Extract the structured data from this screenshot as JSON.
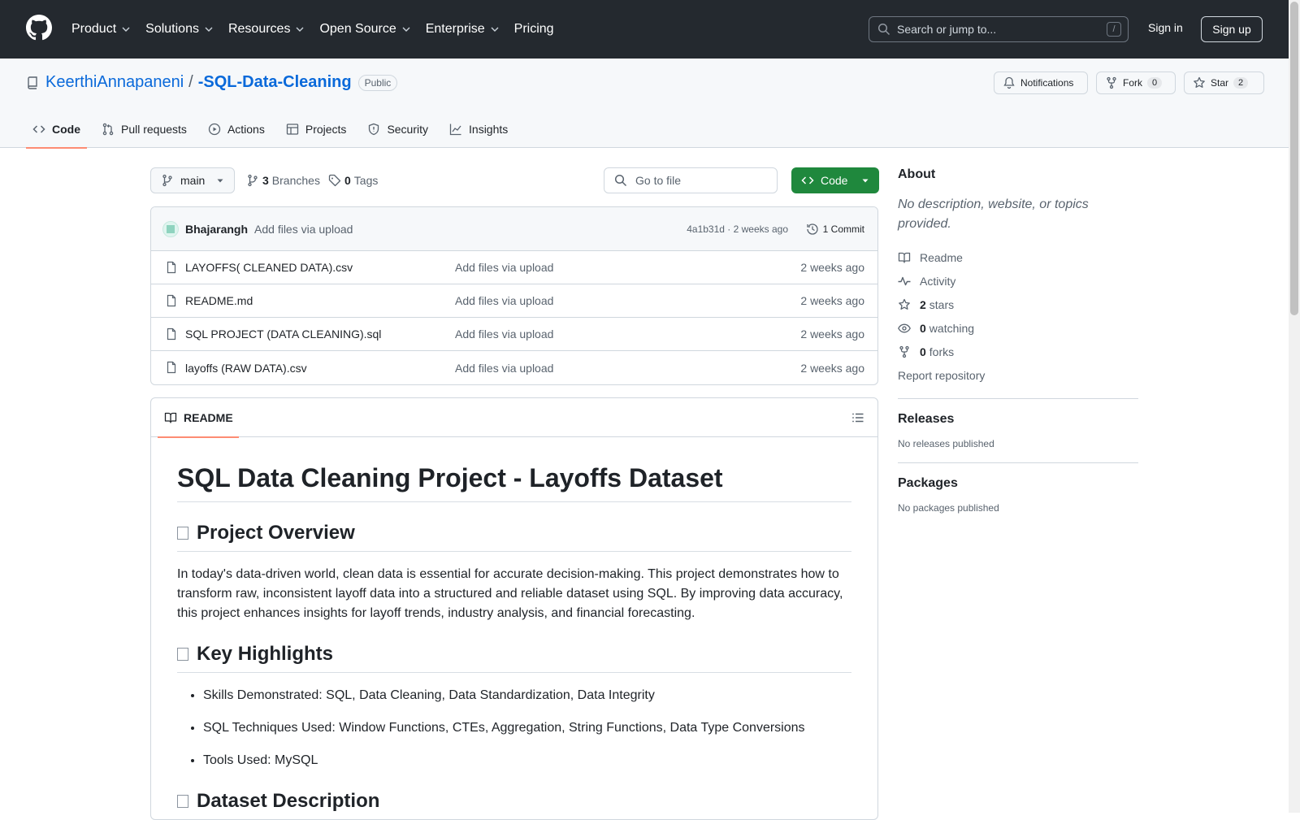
{
  "header": {
    "nav": [
      "Product",
      "Solutions",
      "Resources",
      "Open Source",
      "Enterprise",
      "Pricing"
    ],
    "search_placeholder": "Search or jump to...",
    "search_kbd": "/",
    "sign_in": "Sign in",
    "sign_up": "Sign up"
  },
  "repo": {
    "owner": "KeerthiAnnapaneni",
    "separator": "/",
    "name": "-SQL-Data-Cleaning",
    "visibility": "Public",
    "notifications_label": "Notifications",
    "fork_label": "Fork",
    "fork_count": "0",
    "star_label": "Star",
    "star_count": "2"
  },
  "tabs": [
    {
      "label": "Code",
      "icon": "code-icon",
      "active": true
    },
    {
      "label": "Pull requests",
      "icon": "pull-request-icon"
    },
    {
      "label": "Actions",
      "icon": "play-icon"
    },
    {
      "label": "Projects",
      "icon": "table-icon"
    },
    {
      "label": "Security",
      "icon": "shield-icon"
    },
    {
      "label": "Insights",
      "icon": "graph-icon"
    }
  ],
  "branch": {
    "current": "main",
    "branches_count": "3",
    "branches_label": "Branches",
    "tags_count": "0",
    "tags_label": "Tags",
    "go_to_file": "Go to file",
    "code_button": "Code"
  },
  "commit": {
    "author": "Bhajarangh",
    "message": "Add files via upload",
    "hash_time": "4a1b31d · 2 weeks ago",
    "commits_label": "1 Commit"
  },
  "files": [
    {
      "name": "LAYOFFS( CLEANED DATA).csv",
      "message": "Add files via upload",
      "date": "2 weeks ago"
    },
    {
      "name": "README.md",
      "message": "Add files via upload",
      "date": "2 weeks ago"
    },
    {
      "name": "SQL PROJECT (DATA CLEANING).sql",
      "message": "Add files via upload",
      "date": "2 weeks ago"
    },
    {
      "name": "layoffs (RAW DATA).csv",
      "message": "Add files via upload",
      "date": "2 weeks ago"
    }
  ],
  "readme": {
    "tab_label": "README",
    "title": "SQL Data Cleaning Project - Layoffs Dataset",
    "h_overview": "Project Overview",
    "overview_text": "In today's data-driven world, clean data is essential for accurate decision-making. This project demonstrates how to transform raw, inconsistent layoff data into a structured and reliable dataset using SQL. By improving data accuracy, this project enhances insights for layoff trends, industry analysis, and financial forecasting.",
    "h_highlights": "Key Highlights",
    "highlights": [
      "Skills Demonstrated: SQL, Data Cleaning, Data Standardization, Data Integrity",
      "SQL Techniques Used: Window Functions, CTEs, Aggregation, String Functions, Data Type Conversions",
      "Tools Used: MySQL"
    ],
    "h_dataset": "Dataset Description"
  },
  "about": {
    "heading": "About",
    "description": "No description, website, or topics provided.",
    "readme": "Readme",
    "activity": "Activity",
    "stars_count": "2",
    "stars_label": "stars",
    "watching_count": "0",
    "watching_label": "watching",
    "forks_count": "0",
    "forks_label": "forks",
    "report": "Report repository"
  },
  "releases": {
    "heading": "Releases",
    "empty": "No releases published"
  },
  "packages": {
    "heading": "Packages",
    "empty": "No packages published"
  }
}
